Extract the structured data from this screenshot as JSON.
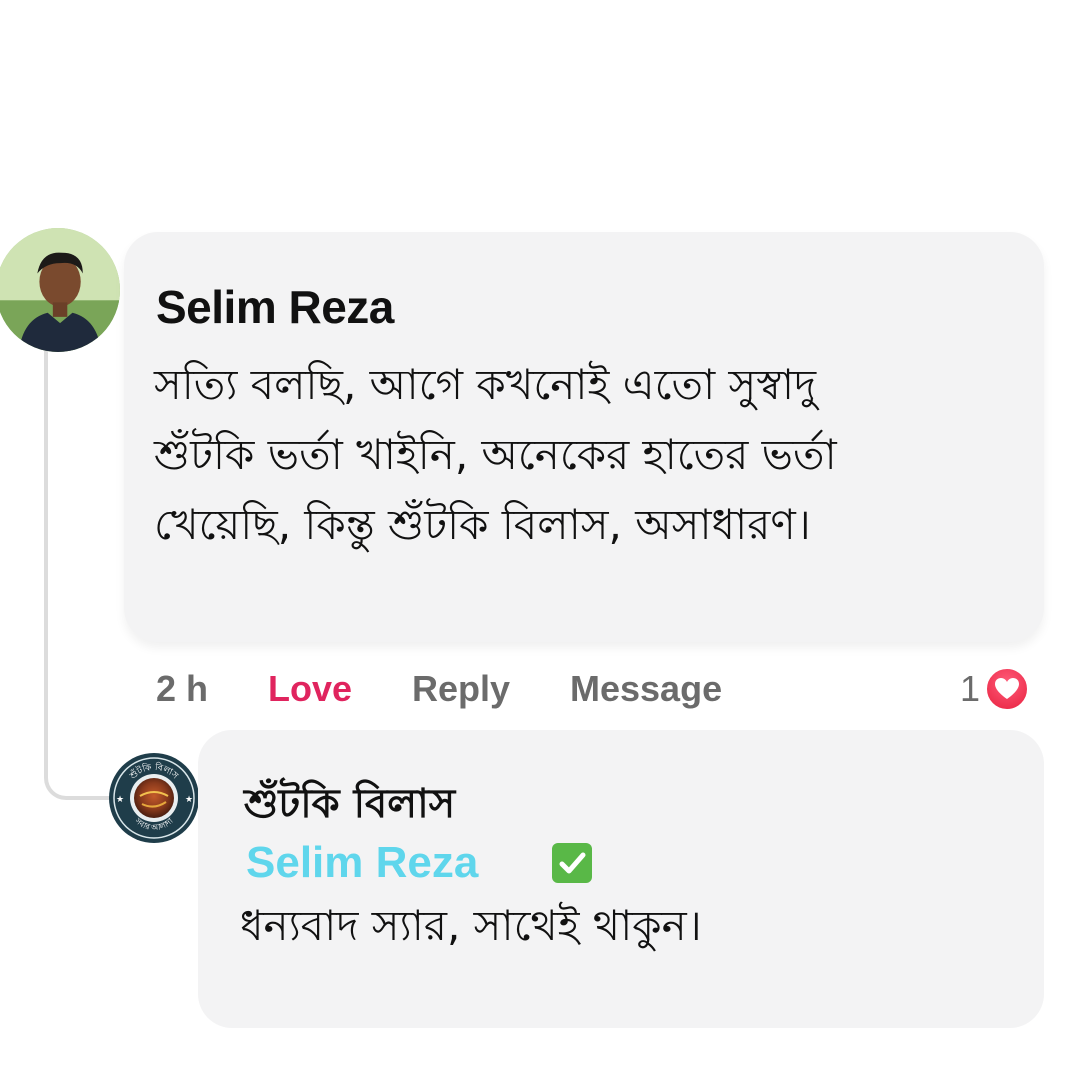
{
  "comment": {
    "author": "Selim Reza",
    "lines": [
      "সত্যি বলছি, আগে কখনোই এতো সুস্বাদু",
      "শুঁটকি ভর্তা খাইনি, অনেকের হাতের ভর্তা",
      "খেয়েছি, কিন্তু শুঁটকি বিলাস, অসাধারণ।"
    ],
    "time": "2 h",
    "actions": {
      "love": "Love",
      "reply": "Reply",
      "message": "Message"
    },
    "reaction_count": "1",
    "reaction_icon": "love-heart-icon"
  },
  "reply": {
    "page_name": "শুঁটকি বিলাস",
    "mention": "Selim Reza",
    "mention_badge_icon": "checkmark-icon",
    "text": "ধন্যবাদ স্যার, সাথেই থাকুন।",
    "logo_text_top": "শুঁটকি বিলাস",
    "logo_text_bottom": "সবার আলাদা"
  },
  "colors": {
    "love": "#e0245e",
    "mention": "#5fd6ec",
    "bubble": "#f3f3f4",
    "muted": "#6b6b6b",
    "check": "#59b847"
  }
}
